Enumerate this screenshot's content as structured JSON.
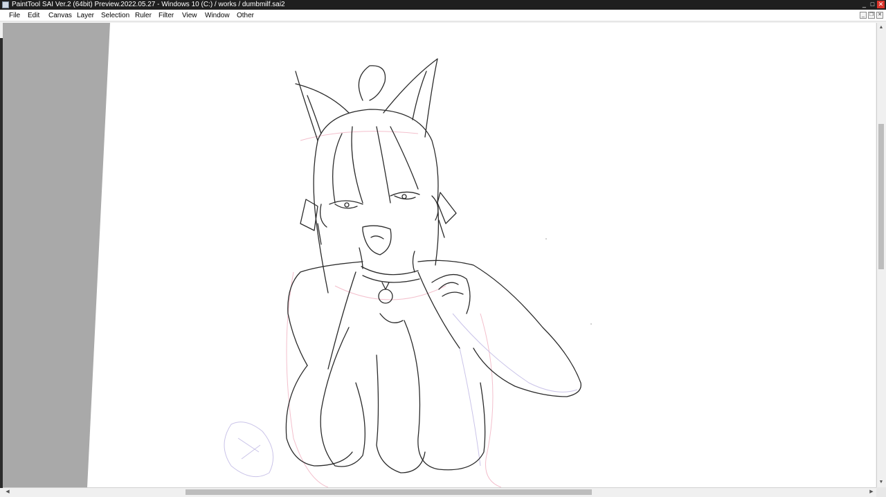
{
  "window": {
    "title": "PaintTool SAI Ver.2 (64bit) Preview.2022.05.27 - Windows 10 (C:) / works / dumbmilf.sai2",
    "minimize": "_",
    "maximize": "□",
    "close": "✕"
  },
  "menu": {
    "items": [
      "File",
      "Edit",
      "Canvas",
      "Layer",
      "Selection",
      "Ruler",
      "Filter",
      "View",
      "Window",
      "Other"
    ]
  },
  "mdi": {
    "minimize": "_",
    "restore": "❐",
    "close": "✕"
  },
  "scroll": {
    "up": "▲",
    "down": "▼",
    "left": "◀",
    "right": "▶"
  },
  "colors": {
    "titlebar": "#1f1f1f",
    "canvas": "#ffffff",
    "side_panel_gray": "#a9a9a9",
    "sketch_line": "#2a2a2a",
    "sketch_pink": "#f2b8c6",
    "sketch_lavender": "#c4bde6",
    "close_red": "#d9342b"
  }
}
